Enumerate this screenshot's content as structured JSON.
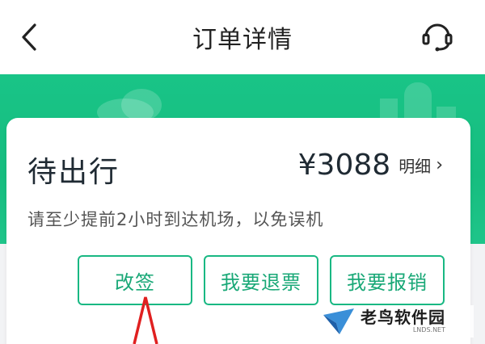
{
  "header": {
    "title": "订单详情",
    "back_icon": "chevron-left-icon",
    "service_icon": "customer-service-icon"
  },
  "order": {
    "status": "待出行",
    "price": "¥3088",
    "detail_label": "明细",
    "notice": "请至少提前2小时到达机场，以免误机"
  },
  "actions": [
    {
      "label": "改签"
    },
    {
      "label": "我要退票"
    },
    {
      "label": "我要报销"
    }
  ],
  "watermark": {
    "main": "老鸟软件园",
    "sub": "LNDS.NET"
  },
  "colors": {
    "accent_green": "#19b883",
    "banner_green": "#19c487",
    "annotation_red": "#e02020"
  }
}
